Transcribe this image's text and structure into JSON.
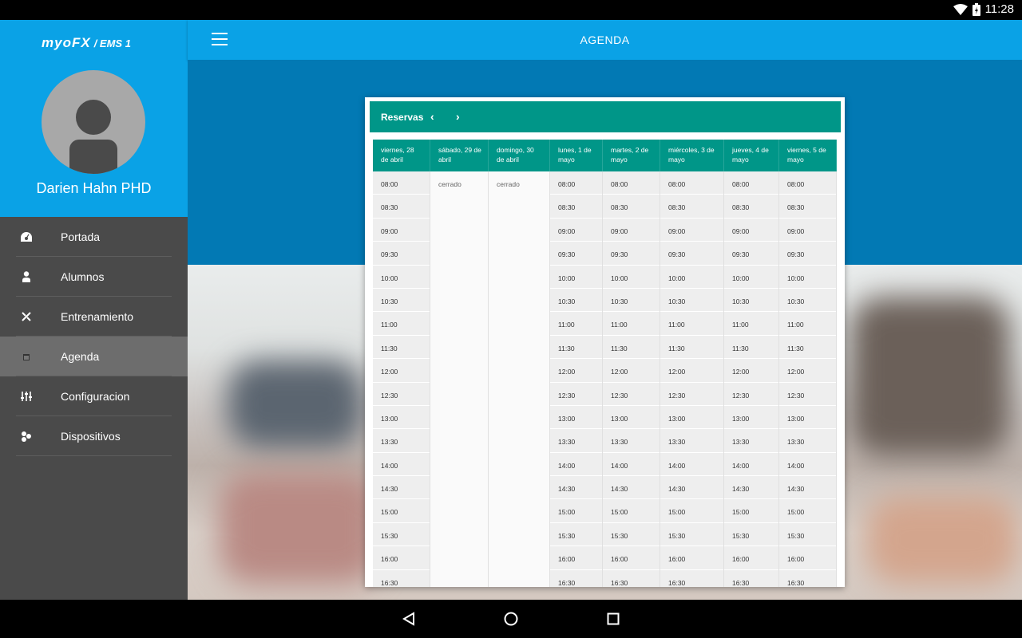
{
  "status_bar": {
    "time": "11:28"
  },
  "app": {
    "logo": "myoFX",
    "logo_suffix": "/ EMS 1",
    "user_name": "Darien Hahn PHD",
    "title": "AGENDA"
  },
  "sidebar": {
    "items": [
      {
        "label": "Portada",
        "icon": "dashboard-icon"
      },
      {
        "label": "Alumnos",
        "icon": "person-icon"
      },
      {
        "label": "Entrenamiento",
        "icon": "training-icon"
      },
      {
        "label": "Agenda",
        "icon": "calendar-icon",
        "active": true
      },
      {
        "label": "Configuracion",
        "icon": "sliders-icon"
      },
      {
        "label": "Dispositivos",
        "icon": "devices-icon"
      }
    ]
  },
  "reservas": {
    "title": "Reservas",
    "prev": "‹",
    "next": "›",
    "days": [
      {
        "label": "viernes, 28 de abril",
        "closed": false
      },
      {
        "label": "sábado, 29 de abril",
        "closed": true
      },
      {
        "label": "domingo, 30 de abril",
        "closed": true
      },
      {
        "label": "lunes, 1 de mayo",
        "closed": false
      },
      {
        "label": "martes, 2 de mayo",
        "closed": false
      },
      {
        "label": "miércoles, 3 de mayo",
        "closed": false
      },
      {
        "label": "jueves, 4 de mayo",
        "closed": false
      },
      {
        "label": "viernes, 5 de mayo",
        "closed": false
      }
    ],
    "closed_label": "cerrado",
    "times": [
      "08:00",
      "08:30",
      "09:00",
      "09:30",
      "10:00",
      "10:30",
      "11:00",
      "11:30",
      "12:00",
      "12:30",
      "13:00",
      "13:30",
      "14:00",
      "14:30",
      "15:00",
      "15:30",
      "16:00",
      "16:30"
    ]
  },
  "colors": {
    "primary": "#0aa2e6",
    "primary_dark": "#0279b4",
    "accent": "#009688",
    "sidebar": "#4a4a4a"
  }
}
